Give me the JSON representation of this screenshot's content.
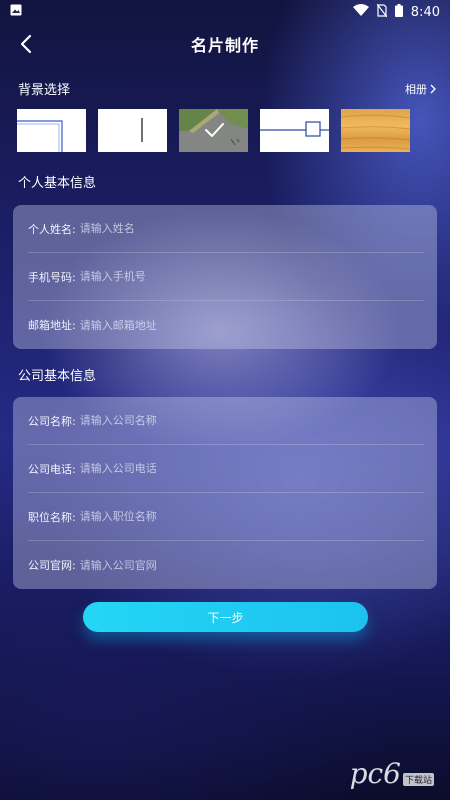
{
  "status": {
    "time": "8:40"
  },
  "header": {
    "title": "名片制作"
  },
  "background": {
    "section_label": "背景选择",
    "album_label": "相册",
    "thumbnails": [
      "template-1",
      "template-2",
      "template-3-selected",
      "template-4",
      "template-5-wood"
    ]
  },
  "personal": {
    "section_label": "个人基本信息",
    "fields": [
      {
        "label": "个人姓名:",
        "placeholder": "请输入姓名"
      },
      {
        "label": "手机号码:",
        "placeholder": "请输入手机号"
      },
      {
        "label": "邮箱地址:",
        "placeholder": "请输入邮箱地址"
      }
    ]
  },
  "company": {
    "section_label": "公司基本信息",
    "fields": [
      {
        "label": "公司名称:",
        "placeholder": "请输入公司名称"
      },
      {
        "label": "公司电话:",
        "placeholder": "请输入公司电话"
      },
      {
        "label": "职位名称:",
        "placeholder": "请输入职位名称"
      },
      {
        "label": "公司官网:",
        "placeholder": "请输入公司官网"
      }
    ]
  },
  "next_label": "下一步",
  "watermark": {
    "main": "pc6",
    "sub": "下载站"
  },
  "colors": {
    "accent": "#24d6f5",
    "bg_dark": "#12143f"
  }
}
